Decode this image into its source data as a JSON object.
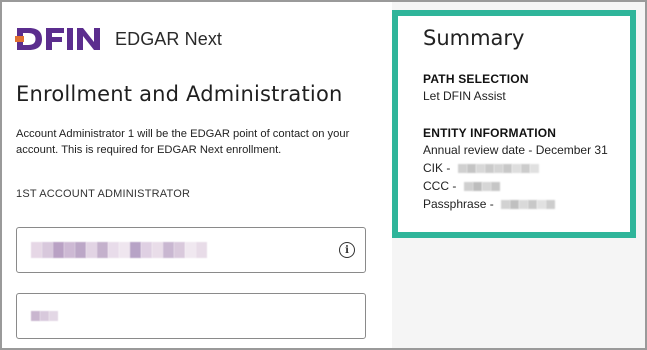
{
  "brand": {
    "logo_text": "DFIN",
    "product": "EDGAR Next",
    "logo_color": "#5b2d8e"
  },
  "left": {
    "title": "Enrollment and Administration",
    "description": "Account Administrator 1 will be the EDGAR point of contact on your account. This is required for EDGAR Next enrollment.",
    "section_label": "1ST ACCOUNT ADMINISTRATOR",
    "field1_icon": "info-icon",
    "field1_icon_glyph": "i"
  },
  "summary": {
    "title": "Summary",
    "path_heading": "PATH SELECTION",
    "path_value": "Let DFIN Assist",
    "entity_heading": "ENTITY INFORMATION",
    "annual_review": "Annual review date - December 31",
    "cik_label": "CIK -",
    "ccc_label": "CCC -",
    "passphrase_label": "Passphrase -",
    "accent_color": "#2fb59a"
  }
}
